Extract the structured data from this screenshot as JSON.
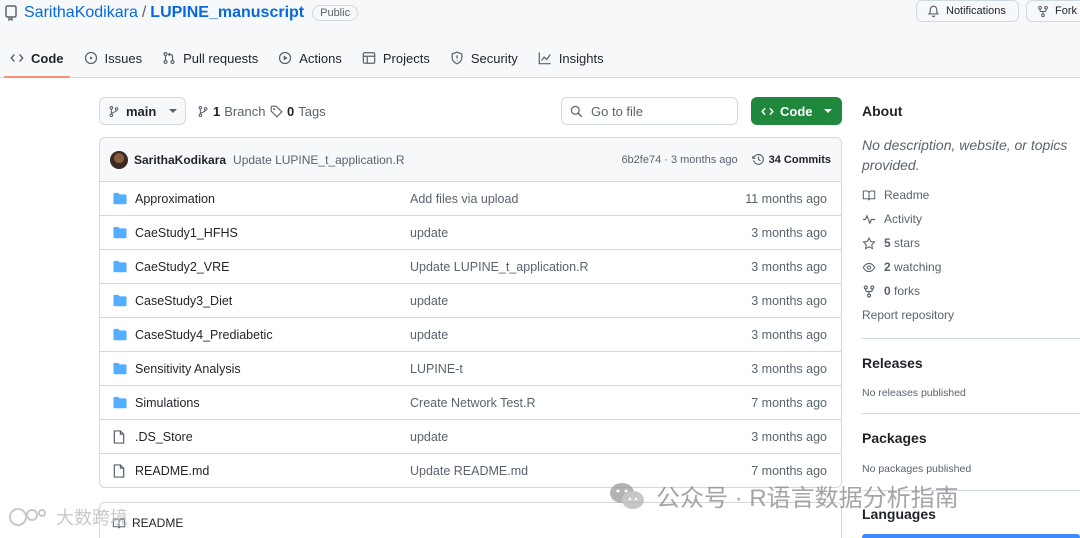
{
  "repo": {
    "owner": "SarithaKodikara",
    "separator": "/",
    "name": "LUPINE_manuscript",
    "visibility": "Public"
  },
  "top_buttons": {
    "notifications": "Notifications",
    "fork": "Fork"
  },
  "tabs": [
    {
      "label": "Code",
      "icon": "code-icon",
      "active": true
    },
    {
      "label": "Issues",
      "icon": "issue-icon"
    },
    {
      "label": "Pull requests",
      "icon": "pull-request-icon"
    },
    {
      "label": "Actions",
      "icon": "play-icon"
    },
    {
      "label": "Projects",
      "icon": "table-icon"
    },
    {
      "label": "Security",
      "icon": "shield-icon"
    },
    {
      "label": "Insights",
      "icon": "graph-icon"
    }
  ],
  "toolbar": {
    "branch": "main",
    "branch_count": "1",
    "branch_label": "Branch",
    "tag_count": "0",
    "tag_label": "Tags",
    "goto_placeholder": "Go to file",
    "code_label": "Code"
  },
  "latest_commit": {
    "author": "SarithaKodikara",
    "message": "Update LUPINE_t_application.R",
    "hash_time": "6b2fe74 · 3 months ago",
    "count": "34 Commits"
  },
  "files": [
    {
      "type": "dir",
      "name": "Approximation",
      "message": "Add files via upload",
      "date": "11 months ago"
    },
    {
      "type": "dir",
      "name": "CaeStudy1_HFHS",
      "message": "update",
      "date": "3 months ago"
    },
    {
      "type": "dir",
      "name": "CaeStudy2_VRE",
      "message": "Update LUPINE_t_application.R",
      "date": "3 months ago"
    },
    {
      "type": "dir",
      "name": "CaseStudy3_Diet",
      "message": "update",
      "date": "3 months ago"
    },
    {
      "type": "dir",
      "name": "CaseStudy4_Prediabetic",
      "message": "update",
      "date": "3 months ago"
    },
    {
      "type": "dir",
      "name": "Sensitivity Analysis",
      "message": "LUPINE-t",
      "date": "3 months ago"
    },
    {
      "type": "dir",
      "name": "Simulations",
      "message": "Create Network Test.R",
      "date": "7 months ago"
    },
    {
      "type": "file",
      "name": ".DS_Store",
      "message": "update",
      "date": "3 months ago"
    },
    {
      "type": "file",
      "name": "README.md",
      "message": "Update README.md",
      "date": "7 months ago"
    }
  ],
  "readme_label": "README",
  "about": {
    "title": "About",
    "description": "No description, website, or topics provided.",
    "readme": "Readme",
    "activity": "Activity",
    "stars_count": "5",
    "stars_label": "stars",
    "watching_count": "2",
    "watching_label": "watching",
    "forks_count": "0",
    "forks_label": "forks",
    "report": "Report repository"
  },
  "releases": {
    "title": "Releases",
    "note": "No releases published"
  },
  "packages": {
    "title": "Packages",
    "note": "No packages published"
  },
  "languages": {
    "title": "Languages"
  },
  "watermarks": {
    "main": "公众号 · R语言数据分析指南",
    "left": "大数跨境"
  },
  "colors": {
    "accent": "#0969da",
    "green": "#1f883d",
    "folder": "#54aeff",
    "tab_underline": "#fd8c73"
  }
}
